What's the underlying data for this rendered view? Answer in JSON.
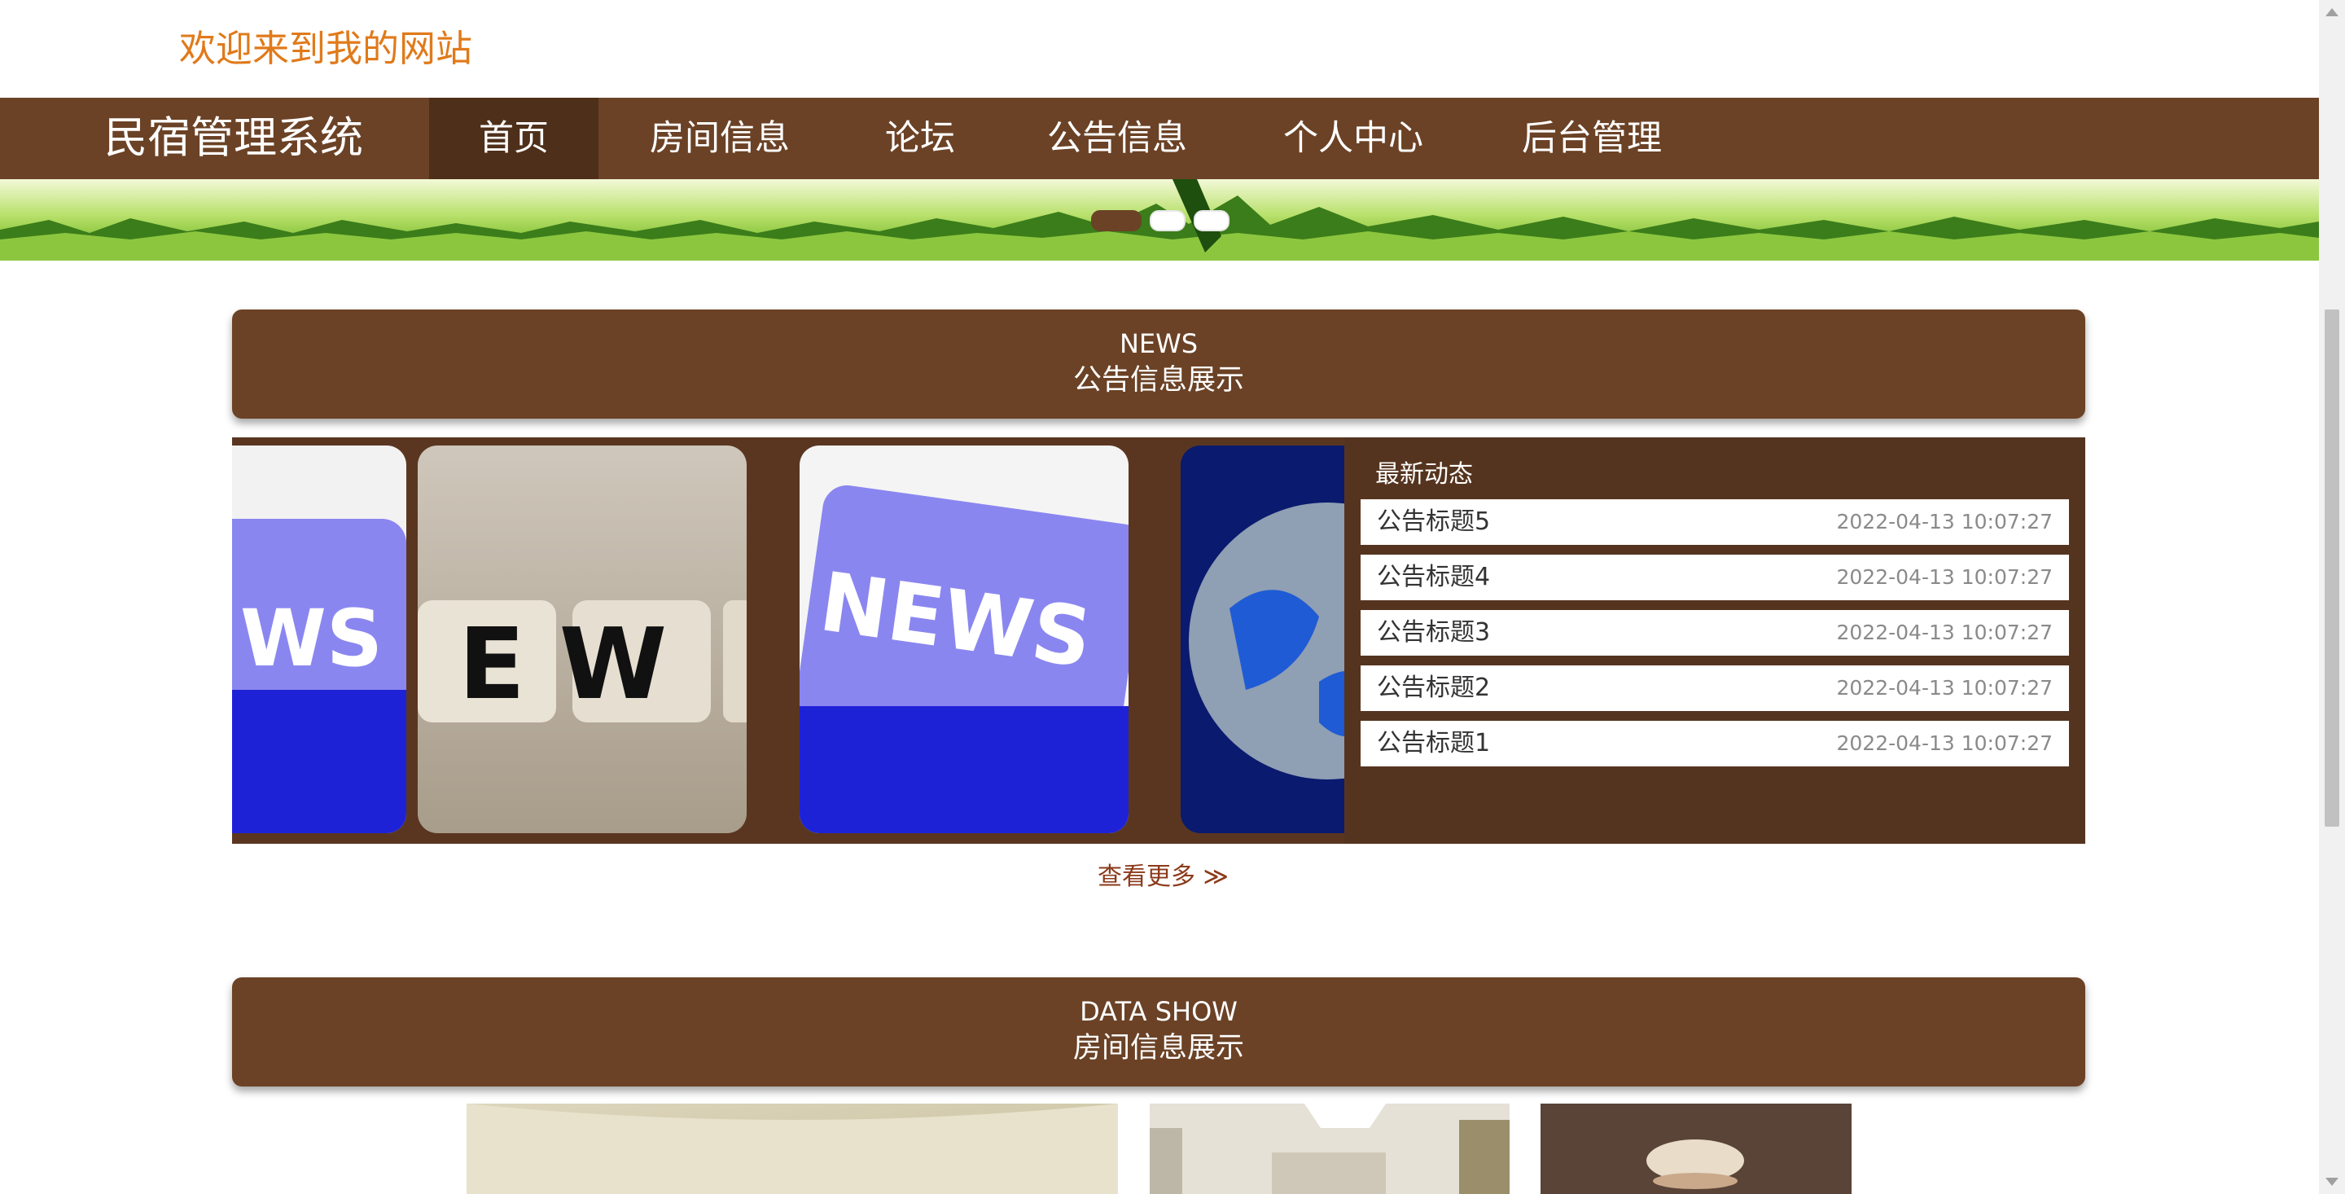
{
  "header": {
    "welcome": "欢迎来到我的网站"
  },
  "nav": {
    "brand": "民宿管理系统",
    "items": [
      {
        "label": "首页",
        "active": true
      },
      {
        "label": "房间信息",
        "active": false
      },
      {
        "label": "论坛",
        "active": false
      },
      {
        "label": "公告信息",
        "active": false
      },
      {
        "label": "个人中心",
        "active": false
      },
      {
        "label": "后台管理",
        "active": false
      }
    ]
  },
  "banner": {
    "slides": 3,
    "active_slide": 1
  },
  "news_section": {
    "en_title": "NEWS",
    "cn_title": "公告信息展示",
    "slides": [
      {
        "caption": "WS"
      },
      {
        "caption": "E W"
      },
      {
        "caption": "NEWS"
      },
      {
        "caption": ""
      }
    ],
    "latest_title": "最新动态",
    "items": [
      {
        "title": "公告标题5",
        "date": "2022-04-13 10:07:27"
      },
      {
        "title": "公告标题4",
        "date": "2022-04-13 10:07:27"
      },
      {
        "title": "公告标题3",
        "date": "2022-04-13 10:07:27"
      },
      {
        "title": "公告标题2",
        "date": "2022-04-13 10:07:27"
      },
      {
        "title": "公告标题1",
        "date": "2022-04-13 10:07:27"
      }
    ],
    "more_label": "查看更多 ≫"
  },
  "data_section": {
    "en_title": "DATA SHOW",
    "cn_title": "房间信息展示"
  },
  "colors": {
    "primary": "#6b4226",
    "accent": "#e07a1a",
    "dark": "#55341f"
  }
}
